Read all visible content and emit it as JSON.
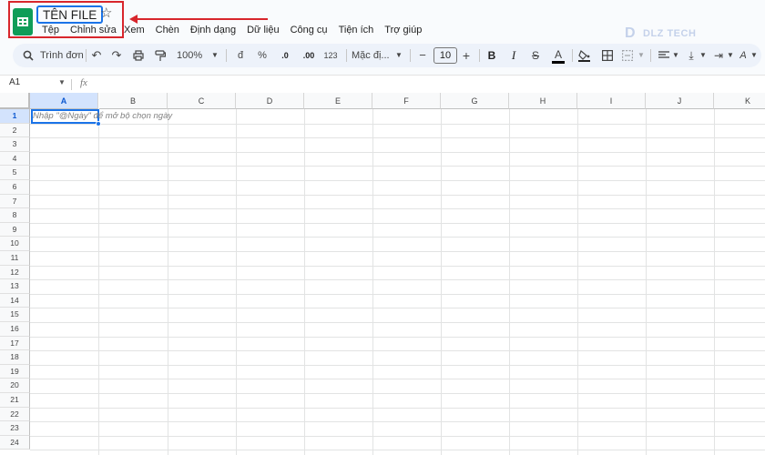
{
  "header": {
    "file_name": "TÊN FILE",
    "star_icon": "star-icon",
    "menu": [
      "Tệp",
      "Chỉnh sửa",
      "Xem",
      "Chèn",
      "Định dạng",
      "Dữ liệu",
      "Công cụ",
      "Tiện ích",
      "Trợ giúp"
    ],
    "watermark": "DLZ TECH"
  },
  "toolbar": {
    "search_label": "Trình đơn",
    "zoom": "100%",
    "currency": "đ",
    "percent": "%",
    "decrease_decimal": ".0",
    "increase_decimal": ".00",
    "number_format": "123",
    "font_name": "Mặc đị...",
    "font_size": "10",
    "minus": "−",
    "plus": "+",
    "bold": "B",
    "italic": "I",
    "text_color": "A"
  },
  "formula_bar": {
    "cell_ref": "A1",
    "fx": "fx"
  },
  "sheet": {
    "columns": [
      "A",
      "B",
      "C",
      "D",
      "E",
      "F",
      "G",
      "H",
      "I",
      "J",
      "K"
    ],
    "rows": [
      "1",
      "2",
      "3",
      "4",
      "5",
      "6",
      "7",
      "8",
      "9",
      "10",
      "11",
      "12",
      "13",
      "14",
      "15",
      "16",
      "17",
      "18",
      "19",
      "20",
      "21",
      "22",
      "23",
      "24"
    ],
    "selected_cell": "A1",
    "cell_hint": "Nhập \"@Ngày\" để mở bộ chọn ngày"
  },
  "colors": {
    "accent": "#1a73e8",
    "highlight": "#d8262c",
    "sheets_green": "#0f9d58"
  }
}
